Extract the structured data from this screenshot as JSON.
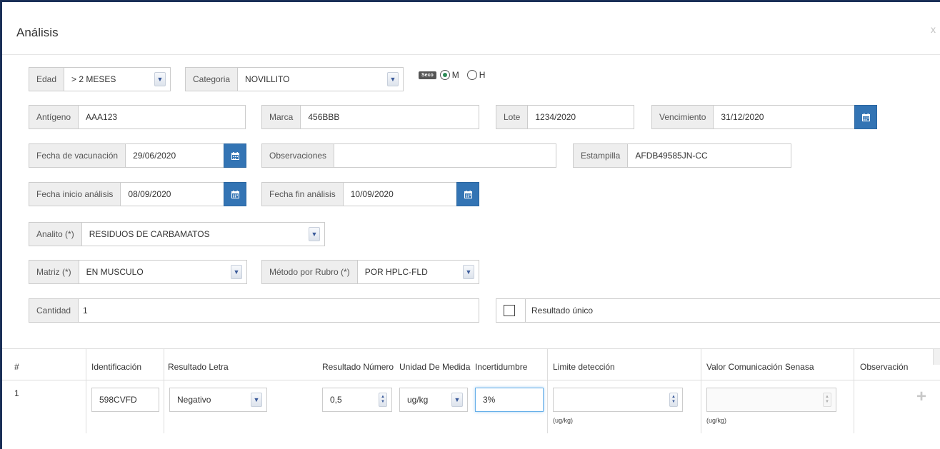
{
  "dialog": {
    "title": "Análisis",
    "close": "x"
  },
  "form": {
    "edad": {
      "label": "Edad",
      "value": "> 2 MESES"
    },
    "categoria": {
      "label": "Categoria",
      "value": "NOVILLITO"
    },
    "sexo": {
      "label": "Sexo",
      "options": [
        "M",
        "H"
      ],
      "selected": "M"
    },
    "antigeno": {
      "label": "Antígeno",
      "value": "AAA123"
    },
    "marca": {
      "label": "Marca",
      "value": "456BBB"
    },
    "lote": {
      "label": "Lote",
      "value": "1234/2020"
    },
    "vencimiento": {
      "label": "Vencimiento",
      "value": "31/12/2020"
    },
    "fecha_vacunacion": {
      "label": "Fecha de vacunación",
      "value": "29/06/2020"
    },
    "observaciones": {
      "label": "Observaciones",
      "value": ""
    },
    "estampilla": {
      "label": "Estampilla",
      "value": "AFDB49585JN-CC"
    },
    "fecha_inicio": {
      "label": "Fecha inicio análisis",
      "value": "08/09/2020"
    },
    "fecha_fin": {
      "label": "Fecha fin análisis",
      "value": "10/09/2020"
    },
    "analito": {
      "label": "Analito (*)",
      "value": "RESIDUOS DE CARBAMATOS"
    },
    "matriz": {
      "label": "Matriz (*)",
      "value": "EN MUSCULO"
    },
    "metodo": {
      "label": "Método por Rubro (*)",
      "value": "POR HPLC-FLD"
    },
    "cantidad": {
      "label": "Cantidad",
      "value": "1"
    },
    "resultado_unico": {
      "label": "Resultado único",
      "checked": false
    }
  },
  "table": {
    "headers": [
      "#",
      "Identificación",
      "Resultado Letra",
      "Resultado Número",
      "Unidad De Medida",
      "Incertidumbre",
      "Limite detección",
      "Valor Comunicación Senasa",
      "Observación"
    ],
    "rows": [
      {
        "num": "1",
        "identificacion": "598CVFD",
        "resultado_letra": "Negativo",
        "resultado_numero": "0,5",
        "unidad": "ug/kg",
        "incertidumbre": "3%",
        "limite": "",
        "limite_unit": "(ug/kg)",
        "valor": "",
        "valor_unit": "(ug/kg)"
      }
    ]
  }
}
